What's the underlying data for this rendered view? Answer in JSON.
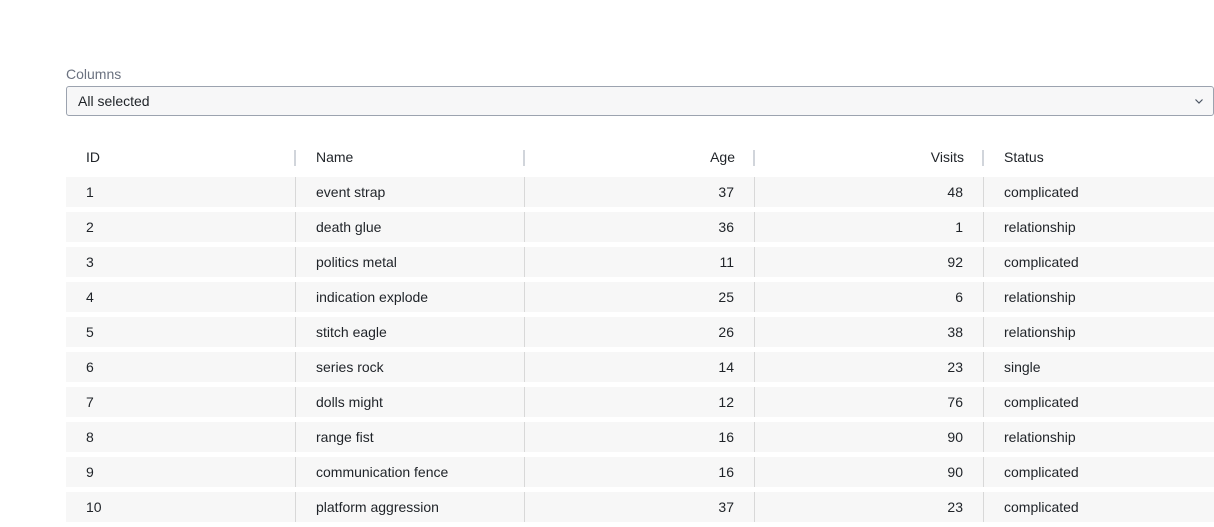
{
  "columns_filter": {
    "label": "Columns",
    "value": "All selected"
  },
  "table": {
    "headers": [
      "ID",
      "Name",
      "Age",
      "Visits",
      "Status"
    ],
    "rows": [
      {
        "id": "1",
        "name": "event strap",
        "age": "37",
        "visits": "48",
        "status": "complicated"
      },
      {
        "id": "2",
        "name": "death glue",
        "age": "36",
        "visits": "1",
        "status": "relationship"
      },
      {
        "id": "3",
        "name": "politics metal",
        "age": "11",
        "visits": "92",
        "status": "complicated"
      },
      {
        "id": "4",
        "name": "indication explode",
        "age": "25",
        "visits": "6",
        "status": "relationship"
      },
      {
        "id": "5",
        "name": "stitch eagle",
        "age": "26",
        "visits": "38",
        "status": "relationship"
      },
      {
        "id": "6",
        "name": "series rock",
        "age": "14",
        "visits": "23",
        "status": "single"
      },
      {
        "id": "7",
        "name": "dolls might",
        "age": "12",
        "visits": "76",
        "status": "complicated"
      },
      {
        "id": "8",
        "name": "range fist",
        "age": "16",
        "visits": "90",
        "status": "relationship"
      },
      {
        "id": "9",
        "name": "communication fence",
        "age": "16",
        "visits": "90",
        "status": "complicated"
      },
      {
        "id": "10",
        "name": "platform aggression",
        "age": "37",
        "visits": "23",
        "status": "complicated"
      }
    ]
  },
  "icons": {
    "dropdown": "chevron-down-icon",
    "resize": "column-resize-handle"
  }
}
